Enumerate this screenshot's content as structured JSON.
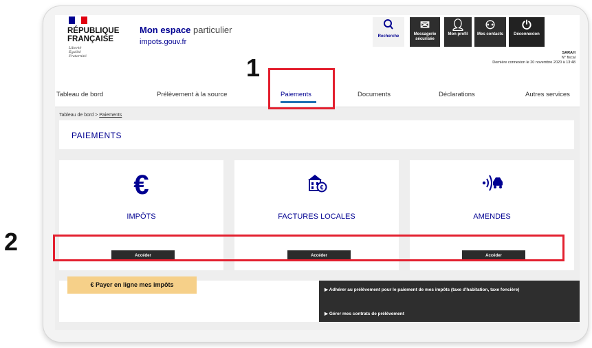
{
  "header": {
    "republic_line1": "RÉPUBLIQUE",
    "republic_line2": "FRANÇAISE",
    "motto1": "Liberté",
    "motto2": "Égalité",
    "motto3": "Fraternité",
    "site_title_bold": "Mon espace",
    "site_title_light": "particulier",
    "site_url": "impots.gouv.fr",
    "buttons": {
      "search": "Recherche",
      "messaging": "Messagerie sécurisée",
      "profile": "Mon profil",
      "contacts": "Mes contacts",
      "logout": "Déconnexion"
    },
    "user_name": "SARAH",
    "fiscal_no": "N° fiscal",
    "last_login": "Dernière connexion le 20 novembre 2020 à 13:48"
  },
  "nav": {
    "items": [
      "Tableau de bord",
      "Prélèvement à la source",
      "Paiements",
      "Documents",
      "Déclarations",
      "Autres services"
    ],
    "active": "Paiements"
  },
  "breadcrumb": {
    "home": "Tableau de bord",
    "sep": ">",
    "current": "Paiements"
  },
  "page": {
    "title": "PAIEMENTS"
  },
  "categories": [
    {
      "label": "IMPÔTS",
      "button": "Accéder",
      "icon": "euro-icon"
    },
    {
      "label": "FACTURES LOCALES",
      "button": "Accéder",
      "icon": "building-euro-icon"
    },
    {
      "label": "AMENDES",
      "button": "Accéder",
      "icon": "car-radar-icon"
    }
  ],
  "payer": {
    "symbol": "€",
    "label": "Payer en ligne mes impôts"
  },
  "links": {
    "adhere": "Adhérer au prélèvement pour le paiement de mes impôts (taxe d'habitation, taxe foncière)",
    "manage": "Gérer mes contrats de prélèvement"
  },
  "annotations": {
    "one": "1",
    "two": "2"
  },
  "colors": {
    "brand_blue": "#000091",
    "annotation_red": "#e3202f",
    "payer_yellow": "#f6d089",
    "dark": "#2e2e2e"
  }
}
